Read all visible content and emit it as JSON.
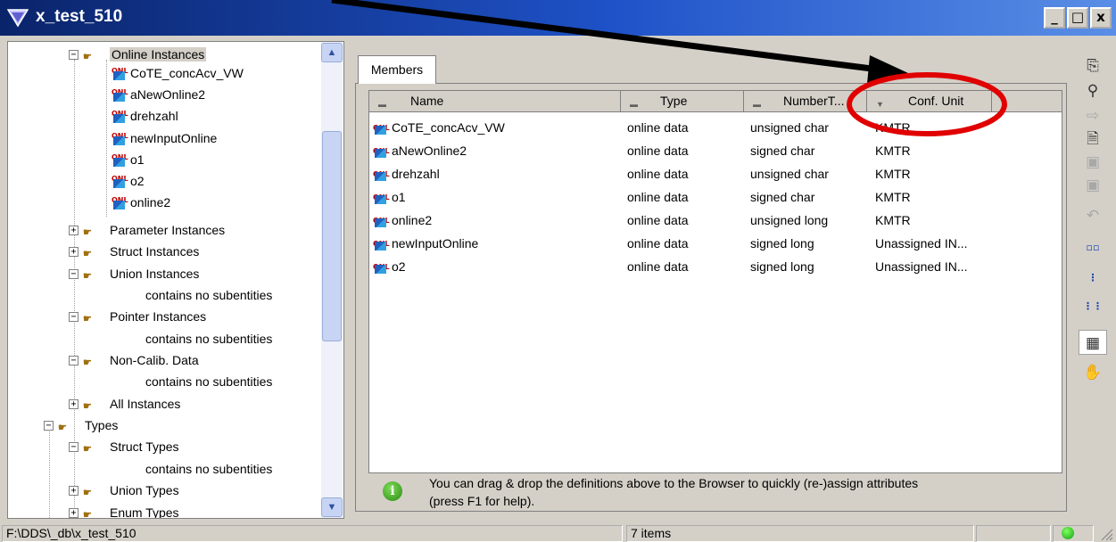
{
  "window": {
    "title": "x_test_510",
    "minimize": "_",
    "maximize": "□",
    "close": "x"
  },
  "tree": {
    "nodes": [
      {
        "label": "Online Instances",
        "type": "folder",
        "expander": "−",
        "selected": true
      },
      {
        "label": "CoTE_concAcv_VW",
        "type": "onl"
      },
      {
        "label": "aNewOnline2",
        "type": "onl"
      },
      {
        "label": "drehzahl",
        "type": "onl"
      },
      {
        "label": "newInputOnline",
        "type": "onl"
      },
      {
        "label": "o1",
        "type": "onl"
      },
      {
        "label": "o2",
        "type": "onl"
      },
      {
        "label": "online2",
        "type": "onl"
      },
      {
        "label": "Parameter Instances",
        "type": "folder",
        "expander": "+"
      },
      {
        "label": "Struct Instances",
        "type": "folder",
        "expander": "+"
      },
      {
        "label": "Union Instances",
        "type": "folder",
        "expander": "−"
      },
      {
        "label": "contains no subentities",
        "type": "leaf"
      },
      {
        "label": "Pointer Instances",
        "type": "folder",
        "expander": "−"
      },
      {
        "label": "contains no subentities",
        "type": "leaf"
      },
      {
        "label": "Non-Calib. Data",
        "type": "folder",
        "expander": "−"
      },
      {
        "label": "contains no subentities",
        "type": "leaf"
      },
      {
        "label": "All Instances",
        "type": "folder",
        "expander": "+"
      },
      {
        "label": "Types",
        "type": "folder",
        "expander": "−"
      },
      {
        "label": "Struct Types",
        "type": "folder",
        "expander": "−"
      },
      {
        "label": "contains no subentities",
        "type": "leaf"
      },
      {
        "label": "Union Types",
        "type": "folder",
        "expander": "+"
      },
      {
        "label": "Enum Types",
        "type": "folder",
        "expander": "+"
      }
    ]
  },
  "members": {
    "tab_label": "Members",
    "columns": [
      "Name",
      "Type",
      "NumberT...",
      "Conf. Unit"
    ],
    "rows": [
      {
        "name": "CoTE_concAcv_VW",
        "type": "online data",
        "number_type": "unsigned char",
        "conf_unit": "KMTR"
      },
      {
        "name": "aNewOnline2",
        "type": "online data",
        "number_type": "signed char",
        "conf_unit": "KMTR"
      },
      {
        "name": "drehzahl",
        "type": "online data",
        "number_type": "unsigned char",
        "conf_unit": "KMTR"
      },
      {
        "name": "o1",
        "type": "online data",
        "number_type": "signed char",
        "conf_unit": "KMTR"
      },
      {
        "name": "online2",
        "type": "online data",
        "number_type": "unsigned long",
        "conf_unit": "KMTR"
      },
      {
        "name": "newInputOnline",
        "type": "online data",
        "number_type": "signed long",
        "conf_unit": "Unassigned IN..."
      },
      {
        "name": "o2",
        "type": "online data",
        "number_type": "signed long",
        "conf_unit": "Unassigned IN..."
      }
    ],
    "row_icon_text": "ONL"
  },
  "info": {
    "line1": "You can drag & drop the definitions above to the Browser to quickly (re-)assign attributes",
    "line2": "(press F1 for help)."
  },
  "status": {
    "path": "F:\\DDS\\_db\\x_test_510",
    "count": "7 items"
  },
  "toolbar": {
    "buttons": [
      "hierarchy-icon",
      "find-icon",
      "forward-icon",
      "document-icon",
      "save-icon",
      "save-all-icon",
      "undo-icon",
      "small-icons-icon",
      "list-icon",
      "details-icon",
      "table-view-icon",
      "handshake-icon"
    ]
  },
  "annotation": {
    "arrow_color": "#000000",
    "ellipse_color": "#e00000"
  }
}
